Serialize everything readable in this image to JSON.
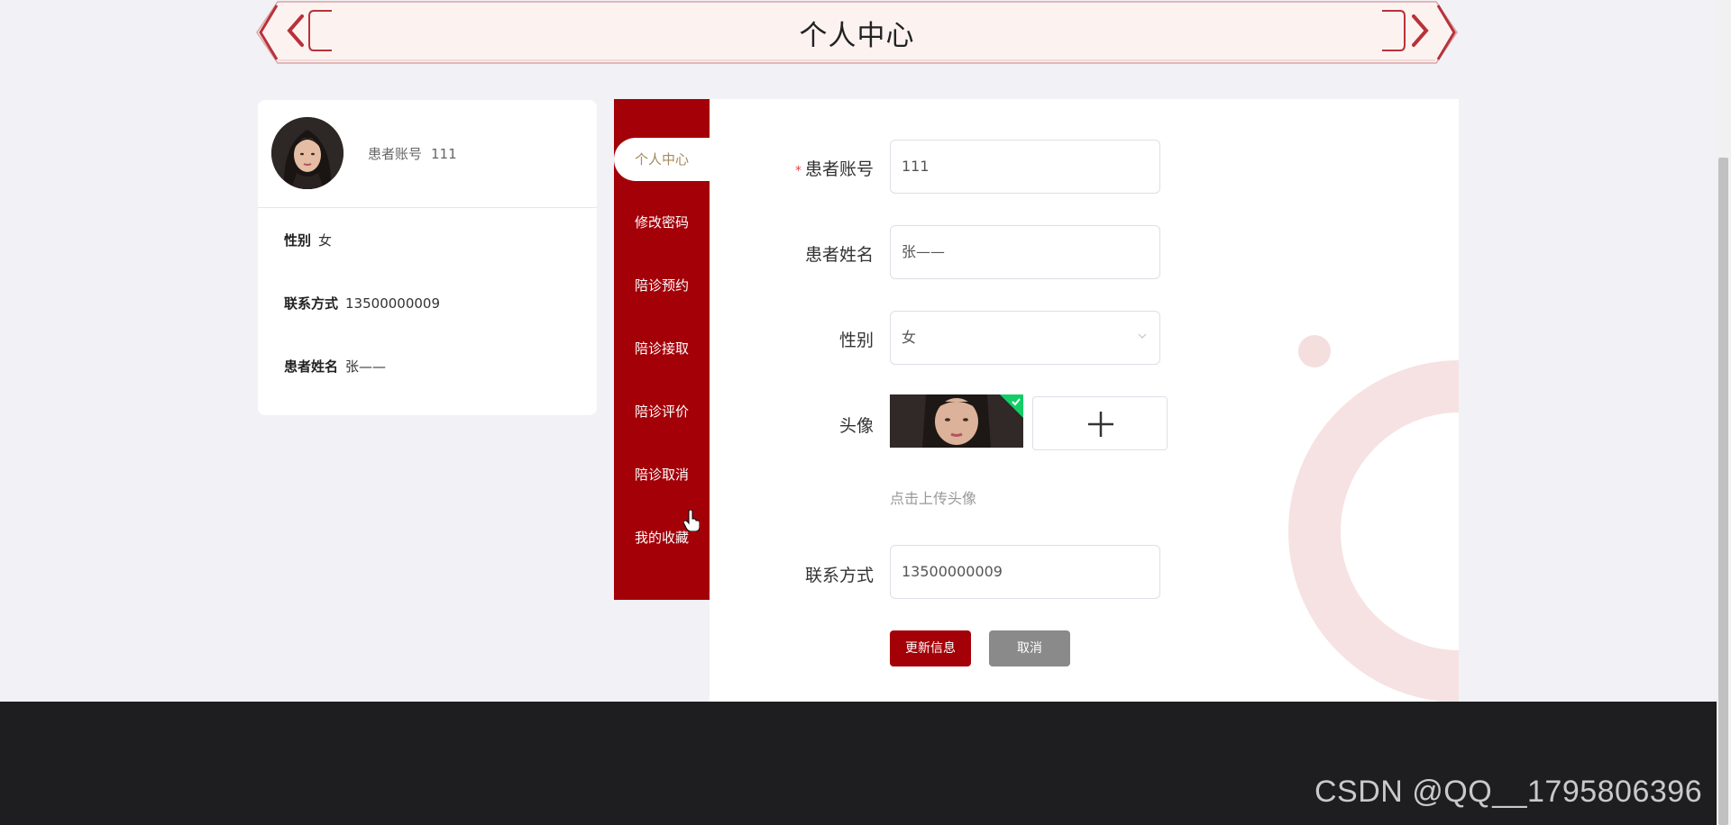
{
  "banner": {
    "title": "个人中心"
  },
  "profile": {
    "account_label": "患者账号",
    "account_value": "111",
    "gender_label": "性别",
    "gender_value": "女",
    "phone_label": "联系方式",
    "phone_value": "13500000009",
    "name_label": "患者姓名",
    "name_value": "张——"
  },
  "menu": {
    "items": [
      {
        "label": "个人中心",
        "active": true
      },
      {
        "label": "修改密码"
      },
      {
        "label": "陪诊预约"
      },
      {
        "label": "陪诊接取"
      },
      {
        "label": "陪诊评价"
      },
      {
        "label": "陪诊取消"
      },
      {
        "label": "我的收藏"
      }
    ]
  },
  "form": {
    "required_mark": "*",
    "account_label": "患者账号",
    "account_value": "111",
    "name_label": "患者姓名",
    "name_value": "张——",
    "gender_label": "性别",
    "gender_value": "女",
    "avatar_label": "头像",
    "upload_hint": "点击上传头像",
    "phone_label": "联系方式",
    "phone_value": "13500000009",
    "update_button": "更新信息",
    "cancel_button": "取消"
  },
  "watermark": "CSDN @QQ__1795806396",
  "icons": {
    "prev": "chevron-left-icon",
    "next": "chevron-right-icon",
    "select": "chevron-down-icon",
    "upload": "plus-icon",
    "uploaded": "check-icon"
  },
  "colors": {
    "primary": "#a40008",
    "menu_active_text": "#a58a5c",
    "cancel": "#8a8a8a",
    "footer": "#1e1e20",
    "success": "#13ce66"
  }
}
